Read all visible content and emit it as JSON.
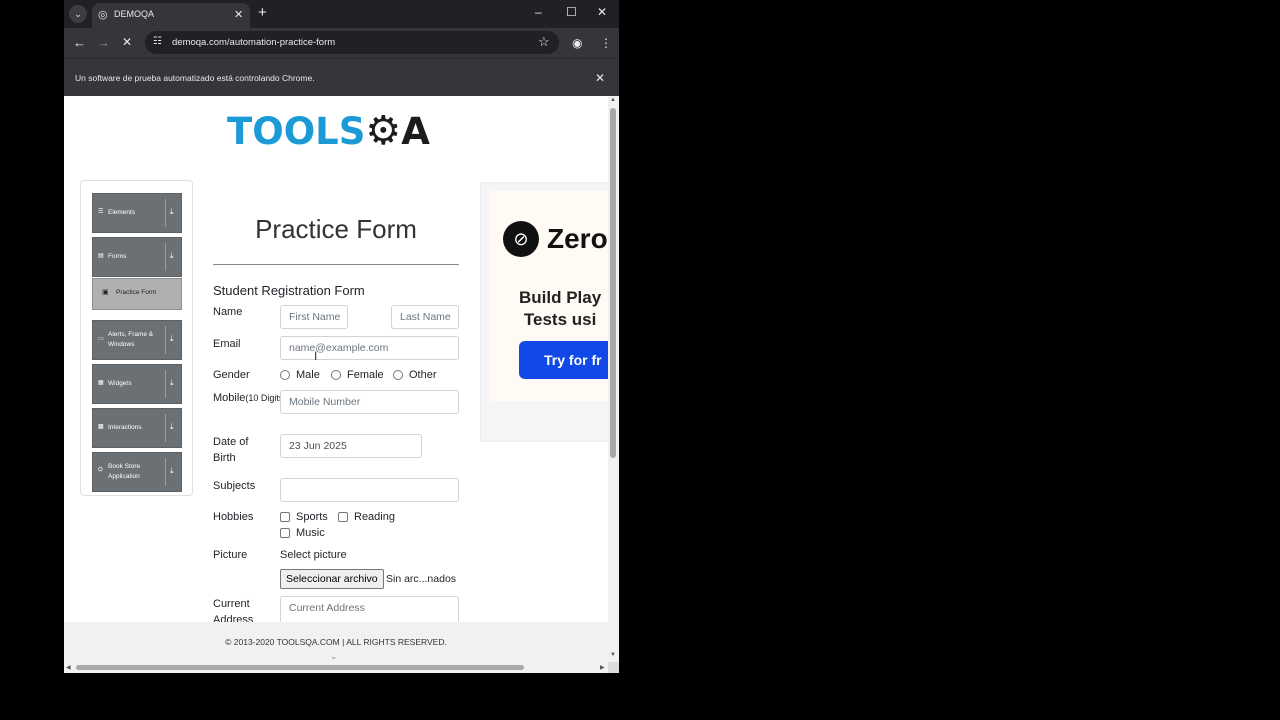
{
  "browser": {
    "tab_title": "DEMOQA",
    "url": "demoqa.com/automation-practice-form",
    "infobar_text": "Un software de prueba automatizado está controlando Chrome."
  },
  "logo": {
    "part1": "TOOLS",
    "part2": "A"
  },
  "sidebar": {
    "groups": [
      {
        "label": "Elements"
      },
      {
        "label": "Forms"
      },
      {
        "label": "Alerts, Frame & Windows"
      },
      {
        "label": "Widgets"
      },
      {
        "label": "Interactions"
      },
      {
        "label": "Book Store Application"
      }
    ],
    "active_item": "Practice Form"
  },
  "page": {
    "title": "Practice Form",
    "form_heading": "Student Registration Form"
  },
  "form": {
    "name_label": "Name",
    "first_name_placeholder": "First Name",
    "last_name_placeholder": "Last Name",
    "email_label": "Email",
    "email_placeholder": "name@example.com",
    "gender_label": "Gender",
    "gender_options": [
      "Male",
      "Female",
      "Other"
    ],
    "mobile_label": "Mobile",
    "mobile_label_small": "(10 Digits)",
    "mobile_placeholder": "Mobile Number",
    "dob_label_1": "Date of",
    "dob_label_2": "Birth",
    "dob_value": "23 Jun 2025",
    "subjects_label": "Subjects",
    "hobbies_label": "Hobbies",
    "hobby_options": [
      "Sports",
      "Reading",
      "Music"
    ],
    "picture_label": "Picture",
    "picture_caption": "Select picture",
    "file_button": "Seleccionar archivo",
    "file_status": "Sin arc...nados",
    "address_label_1": "Current",
    "address_label_2": "Address",
    "address_placeholder": "Current Address"
  },
  "ad": {
    "brand": "Zero",
    "headline_1": "Build Play",
    "headline_2": "Tests usi",
    "button": "Try for fr"
  },
  "footer": {
    "text": "© 2013-2020 TOOLSQA.COM | ALL RIGHTS RESERVED."
  },
  "colors": {
    "accent": "#1c9ad6",
    "sidebar_group": "#6b7075",
    "ad_button": "#1149e8"
  }
}
